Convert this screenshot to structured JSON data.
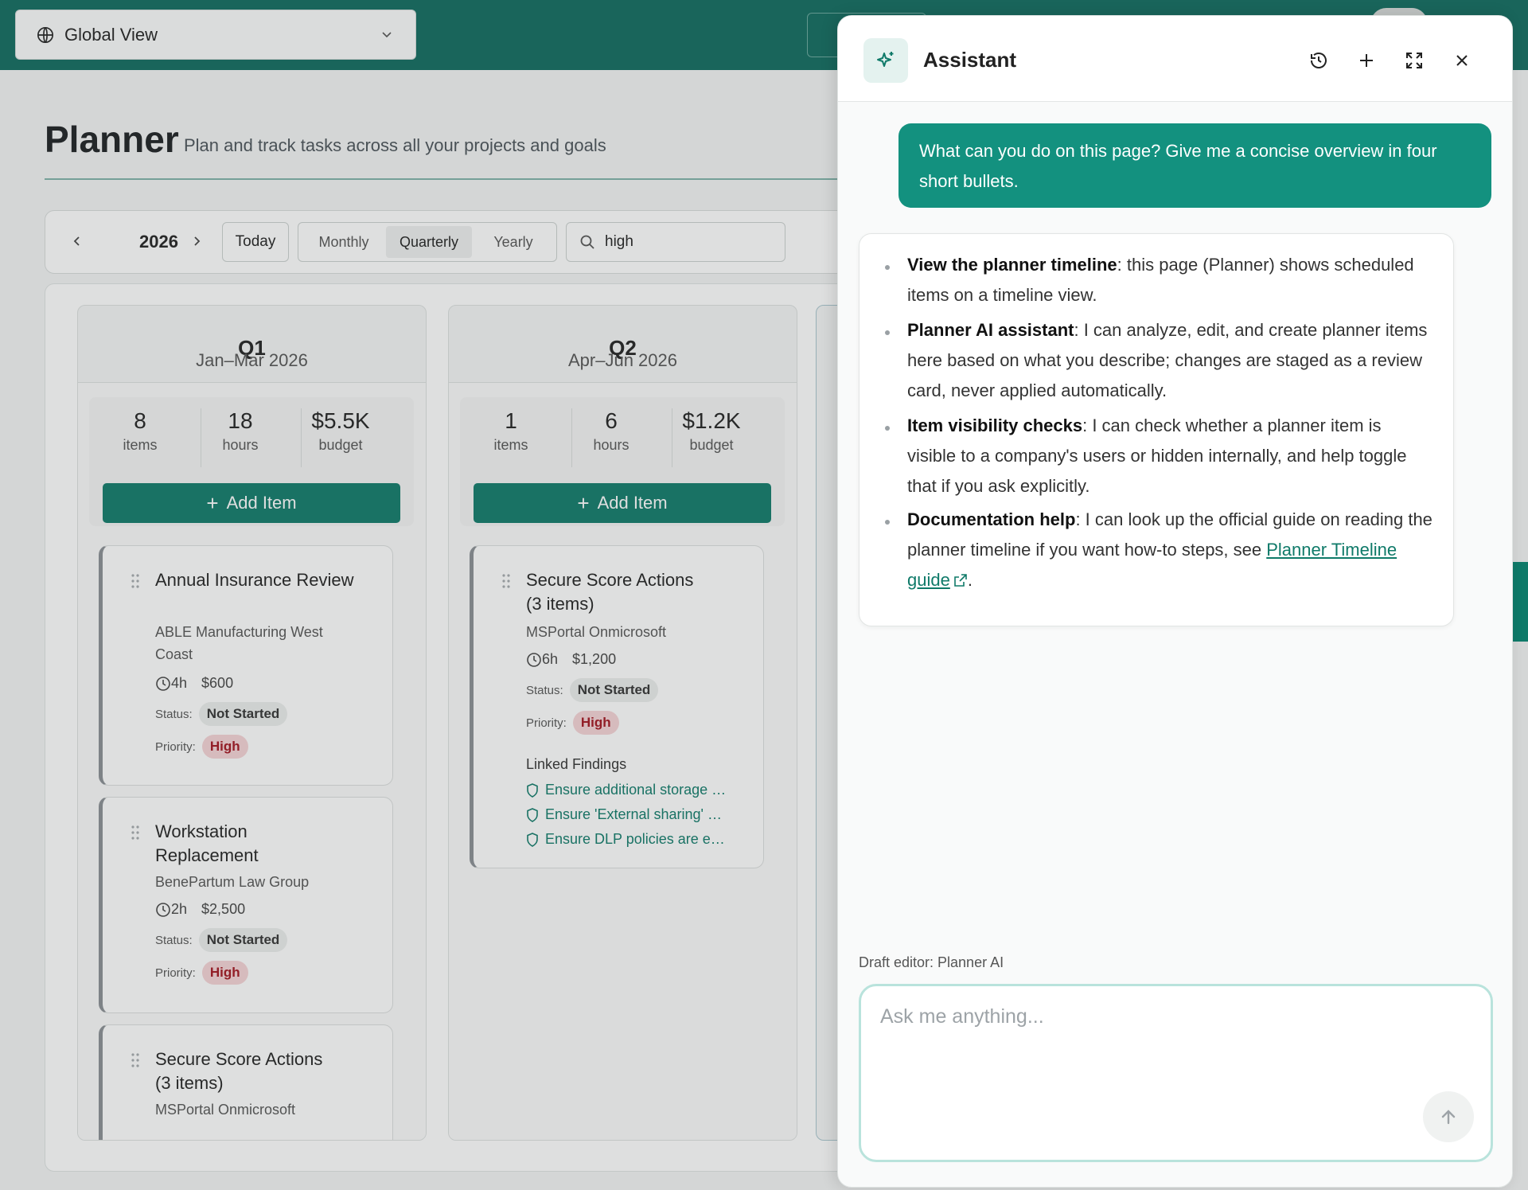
{
  "topbar": {
    "scope_label": "Global View"
  },
  "page": {
    "title": "Planner",
    "subtitle": "Plan and track tasks across all your projects and goals"
  },
  "toolbar": {
    "year": "2026",
    "today": "Today",
    "views": [
      "Monthly",
      "Quarterly",
      "Yearly"
    ],
    "active_view": "Quarterly",
    "search_value": "high"
  },
  "quarters": [
    {
      "name": "Q1",
      "range": "Jan–Mar 2026",
      "stats": {
        "items": "8",
        "items_label": "items",
        "hours": "18",
        "hours_label": "hours",
        "budget": "$5.5K",
        "budget_label": "budget"
      },
      "add_label": "Add Item",
      "cards": [
        {
          "title": "Annual Insurance Review",
          "org": "ABLE Manufacturing West Coast",
          "hours": "4h",
          "cost": "$600",
          "status_label": "Status:",
          "status": "Not Started",
          "priority_label": "Priority:",
          "priority": "High"
        },
        {
          "title": "Workstation Replacement",
          "org": "BenePartum Law Group",
          "hours": "2h",
          "cost": "$2,500",
          "status_label": "Status:",
          "status": "Not Started",
          "priority_label": "Priority:",
          "priority": "High"
        },
        {
          "title": "Secure Score Actions (3 items)",
          "org": "MSPortal Onmicrosoft"
        }
      ]
    },
    {
      "name": "Q2",
      "range": "Apr–Jun 2026",
      "stats": {
        "items": "1",
        "items_label": "items",
        "hours": "6",
        "hours_label": "hours",
        "budget": "$1.2K",
        "budget_label": "budget"
      },
      "add_label": "Add Item",
      "cards": [
        {
          "title": "Secure Score Actions (3 items)",
          "org": "MSPortal Onmicrosoft",
          "hours": "6h",
          "cost": "$1,200",
          "status_label": "Status:",
          "status": "Not Started",
          "priority_label": "Priority:",
          "priority": "High",
          "linked_title": "Linked Findings",
          "linked": [
            "Ensure additional storage …",
            "Ensure 'External sharing' …",
            "Ensure DLP policies are e…"
          ]
        }
      ]
    }
  ],
  "assistant": {
    "title": "Assistant",
    "user_message": "What can you do on this page? Give me a concise overview in four short bullets.",
    "bullets": [
      {
        "bold": "View the planner timeline",
        "text": ": this page (Planner) shows scheduled items on a timeline view."
      },
      {
        "bold": "Planner AI assistant",
        "text": ": I can analyze, edit, and create planner items here based on what you describe; changes are staged as a review card, never applied automatically."
      },
      {
        "bold": "Item visibility checks",
        "text": ": I can check whether a planner item is visible to a company's users or hidden internally, and help toggle that if you ask explicitly."
      },
      {
        "bold": "Documentation help",
        "text": ": I can look up the official guide on reading the planner timeline if you want how-to steps, see ",
        "link": "Planner Timeline guide",
        "tail": "."
      }
    ],
    "draft_label": "Draft editor: Planner AI",
    "input_placeholder": "Ask me anything...",
    "input_value": ""
  },
  "colors": {
    "brand": "#0f6b5e",
    "accent": "#13917f",
    "priority_high": "#a3141f"
  }
}
